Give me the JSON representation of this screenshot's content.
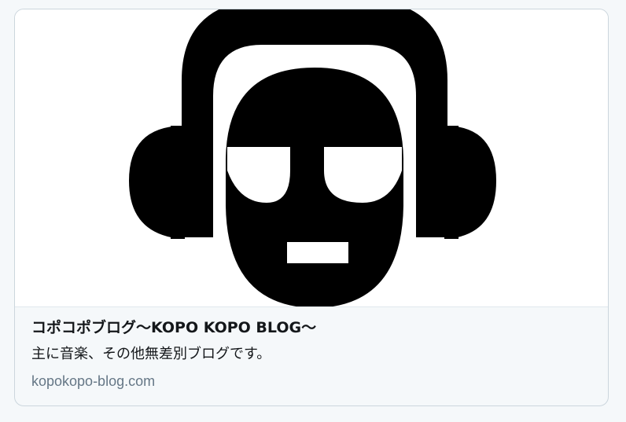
{
  "card": {
    "title": "コポコポブログ〜KOPO KOPO BLOG〜",
    "description": "主に音楽、その他無差別ブログです。",
    "domain": "kopokopo-blog.com"
  },
  "logo": {
    "icon": "headphones-face-logo-icon",
    "foreground_color": "#000000",
    "background_color": "#ffffff"
  }
}
